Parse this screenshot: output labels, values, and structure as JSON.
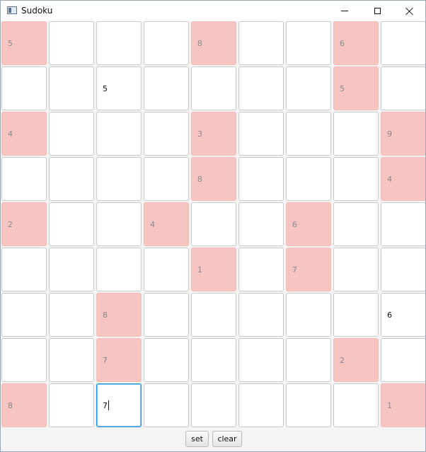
{
  "window": {
    "title": "Sudoku"
  },
  "grid": {
    "rows": [
      [
        {
          "v": "5",
          "given": true
        },
        {
          "v": "",
          "given": false
        },
        {
          "v": "",
          "given": false
        },
        {
          "v": "",
          "given": false
        },
        {
          "v": "8",
          "given": true
        },
        {
          "v": "",
          "given": false
        },
        {
          "v": "",
          "given": false
        },
        {
          "v": "6",
          "given": true
        },
        {
          "v": "",
          "given": false
        }
      ],
      [
        {
          "v": "",
          "given": false
        },
        {
          "v": "",
          "given": false
        },
        {
          "v": "5",
          "given": false
        },
        {
          "v": "",
          "given": false
        },
        {
          "v": "",
          "given": false
        },
        {
          "v": "",
          "given": false
        },
        {
          "v": "",
          "given": false
        },
        {
          "v": "5",
          "given": true
        },
        {
          "v": "",
          "given": false
        }
      ],
      [
        {
          "v": "4",
          "given": true
        },
        {
          "v": "",
          "given": false
        },
        {
          "v": "",
          "given": false
        },
        {
          "v": "",
          "given": false
        },
        {
          "v": "3",
          "given": true
        },
        {
          "v": "",
          "given": false
        },
        {
          "v": "",
          "given": false
        },
        {
          "v": "",
          "given": false
        },
        {
          "v": "9",
          "given": true
        }
      ],
      [
        {
          "v": "",
          "given": false
        },
        {
          "v": "",
          "given": false
        },
        {
          "v": "",
          "given": false
        },
        {
          "v": "",
          "given": false
        },
        {
          "v": "8",
          "given": true
        },
        {
          "v": "",
          "given": false
        },
        {
          "v": "",
          "given": false
        },
        {
          "v": "",
          "given": false
        },
        {
          "v": "4",
          "given": true
        }
      ],
      [
        {
          "v": "2",
          "given": true
        },
        {
          "v": "",
          "given": false
        },
        {
          "v": "",
          "given": false
        },
        {
          "v": "4",
          "given": true
        },
        {
          "v": "",
          "given": false
        },
        {
          "v": "",
          "given": false
        },
        {
          "v": "6",
          "given": true
        },
        {
          "v": "",
          "given": false
        },
        {
          "v": "",
          "given": false
        }
      ],
      [
        {
          "v": "",
          "given": false
        },
        {
          "v": "",
          "given": false
        },
        {
          "v": "",
          "given": false
        },
        {
          "v": "",
          "given": false
        },
        {
          "v": "1",
          "given": true
        },
        {
          "v": "",
          "given": false
        },
        {
          "v": "7",
          "given": true
        },
        {
          "v": "",
          "given": false
        },
        {
          "v": "",
          "given": false
        }
      ],
      [
        {
          "v": "",
          "given": false
        },
        {
          "v": "",
          "given": false
        },
        {
          "v": "8",
          "given": true
        },
        {
          "v": "",
          "given": false
        },
        {
          "v": "",
          "given": false
        },
        {
          "v": "",
          "given": false
        },
        {
          "v": "",
          "given": false
        },
        {
          "v": "",
          "given": false
        },
        {
          "v": "6",
          "given": false
        }
      ],
      [
        {
          "v": "",
          "given": false
        },
        {
          "v": "",
          "given": false
        },
        {
          "v": "7",
          "given": true
        },
        {
          "v": "",
          "given": false
        },
        {
          "v": "",
          "given": false
        },
        {
          "v": "",
          "given": false
        },
        {
          "v": "",
          "given": false
        },
        {
          "v": "2",
          "given": true
        },
        {
          "v": "",
          "given": false
        }
      ],
      [
        {
          "v": "8",
          "given": true
        },
        {
          "v": "",
          "given": false
        },
        {
          "v": "7",
          "given": false,
          "focused": true
        },
        {
          "v": "",
          "given": false
        },
        {
          "v": "",
          "given": false
        },
        {
          "v": "",
          "given": false
        },
        {
          "v": "",
          "given": false
        },
        {
          "v": "",
          "given": false
        },
        {
          "v": "1",
          "given": true
        }
      ]
    ]
  },
  "buttons": {
    "set_label": "set",
    "clear_label": "clear"
  },
  "colors": {
    "given_fill": "#f7c5c1",
    "focus_border": "#1f93d6"
  }
}
